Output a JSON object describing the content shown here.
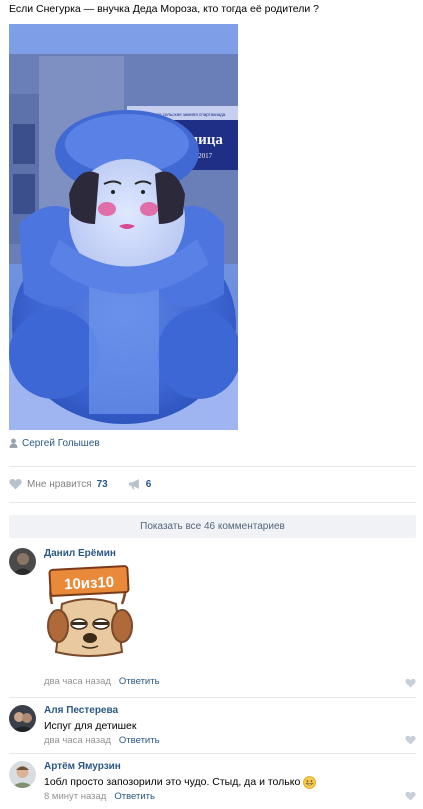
{
  "post": {
    "text": "Если Снегурка — внучка Деда Мороза, кто тогда её родители ?",
    "author": "Сергей Голышев"
  },
  "photo": {
    "banner_line1": "Областная сельская зимняя спартакиада",
    "banner_line2": "теплица",
    "banner_line3": "Ишим 2017"
  },
  "actions": {
    "like_label": "Мне нравится",
    "like_count": "73",
    "share_count": "6"
  },
  "comments_bar": {
    "show_all_label": "Показать все 46 комментариев"
  },
  "comments": [
    {
      "name": "Данил Ерёмин",
      "text": "",
      "sticker_text": "10из10",
      "time": "два часа назад",
      "reply_label": "Ответить"
    },
    {
      "name": "Аля Пестерева",
      "text": "Испуг для детишек",
      "time": "два часа назад",
      "reply_label": "Ответить"
    },
    {
      "name": "Артём Ямурзин",
      "text": "1обл просто запозорили это чудо. Стыд, да и только",
      "time": "8 минут назад",
      "reply_label": "Ответить"
    }
  ],
  "colors": {
    "link": "#2a5885",
    "meta": "#939393",
    "divider": "#e7e8ec",
    "show_all_bg": "#f0f2f5"
  }
}
